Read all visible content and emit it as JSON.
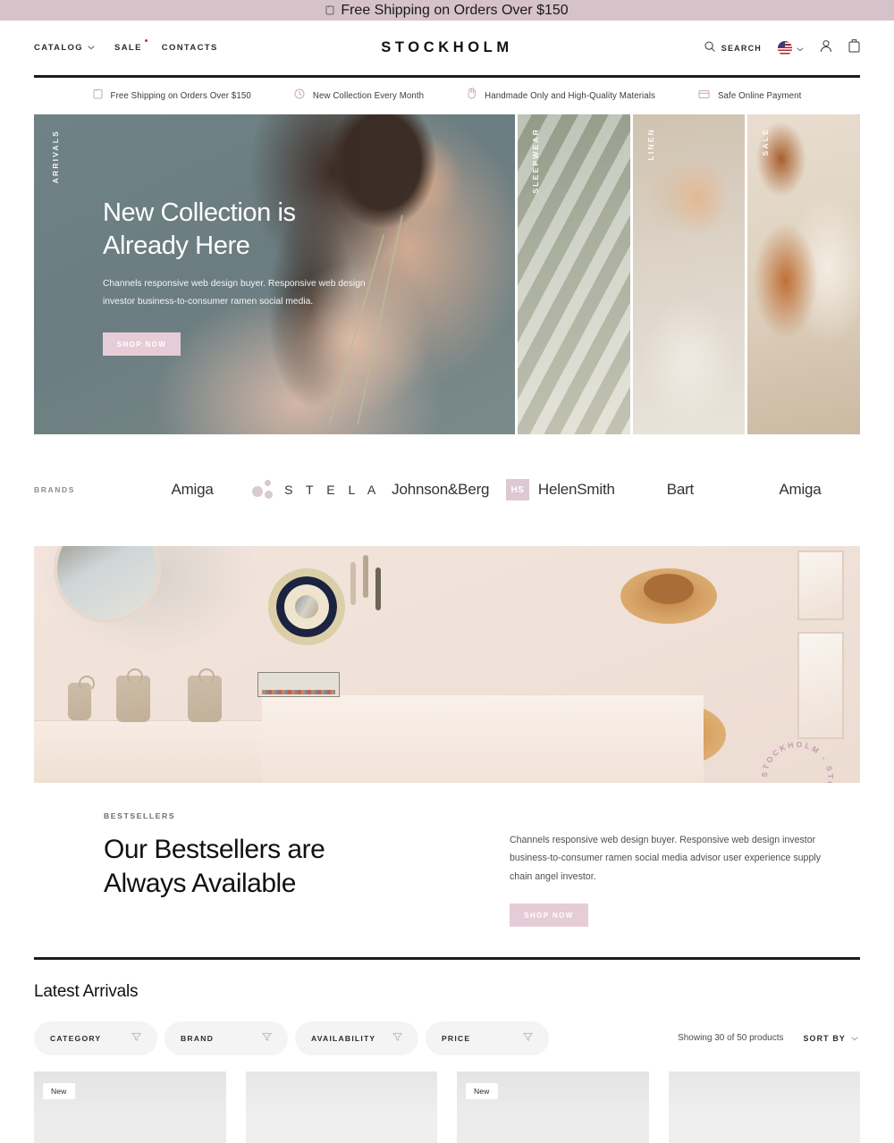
{
  "announcement": {
    "icon": "tag-icon",
    "text": "Free Shipping on Orders Over $150"
  },
  "header": {
    "logo": "STOCKHOLM",
    "nav": [
      {
        "label": "CATALOG",
        "has_chevron": true,
        "has_dot": false
      },
      {
        "label": "SALE",
        "has_chevron": false,
        "has_dot": true
      },
      {
        "label": "CONTACTS",
        "has_chevron": false,
        "has_dot": false
      }
    ],
    "search_label": "SEARCH",
    "locale": "US",
    "account_icon": "user-icon",
    "cart_icon": "bag-icon"
  },
  "usp": [
    {
      "icon": "tag-icon",
      "text": "Free Shipping on Orders Over $150"
    },
    {
      "icon": "clock-icon",
      "text": "New Collection Every Month"
    },
    {
      "icon": "hand-icon",
      "text": "Handmade Only and High-Quality Materials"
    },
    {
      "icon": "card-icon",
      "text": "Safe Online Payment"
    }
  ],
  "hero": {
    "main": {
      "vertical_label": "ARRIVALS",
      "title_line1": "New Collection is",
      "title_line2": "Already Here",
      "subtitle": "Channels responsive web design buyer. Responsive web design investor business-to-consumer ramen social media.",
      "cta": "SHOP NOW"
    },
    "tiles": [
      {
        "vertical_label": "SLEEPWEAR"
      },
      {
        "vertical_label": "LINEN"
      },
      {
        "vertical_label": "SALE"
      }
    ]
  },
  "brands": {
    "label": "BRANDS",
    "items": [
      {
        "name": "Amiga",
        "style": "plain"
      },
      {
        "name": "S T E L A",
        "style": "dots"
      },
      {
        "name": "Johnson&Berg",
        "style": "plain"
      },
      {
        "name": "HelenSmith",
        "style": "badge",
        "badge": "HS"
      },
      {
        "name": "Bart",
        "style": "plain"
      },
      {
        "name": "Amiga",
        "style": "plain"
      }
    ]
  },
  "bestsellers": {
    "stamp_text": "STOCKHOLM - STOCKHOLM - ",
    "eyebrow": "BESTSELLERS",
    "title_line1": "Our Bestsellers are",
    "title_line2": "Always Available",
    "text": "Channels responsive web design buyer. Responsive web design investor business-to-consumer ramen social media advisor user experience supply chain angel investor.",
    "cta": "SHOP NOW"
  },
  "arrivals": {
    "title": "Latest Arrivals",
    "filters": [
      {
        "label": "CATEGORY",
        "icon": "filter-icon"
      },
      {
        "label": "BRAND",
        "icon": "filter-icon"
      },
      {
        "label": "AVAILABILITY",
        "icon": "filter-icon"
      },
      {
        "label": "PRICE",
        "icon": "filter-icon"
      }
    ],
    "showing": "Showing 30 of 50 products",
    "sort_label": "SORT BY",
    "products": [
      {
        "badge": "New"
      },
      {
        "badge": ""
      },
      {
        "badge": "New"
      },
      {
        "badge": ""
      }
    ]
  },
  "colors": {
    "announcement_bg": "#d6c3ca",
    "accent_pink": "#e6ccd6",
    "accent_mauve": "#c39aad",
    "rule_dark": "#1c1c1c",
    "filter_bg": "#f4f4f4"
  }
}
